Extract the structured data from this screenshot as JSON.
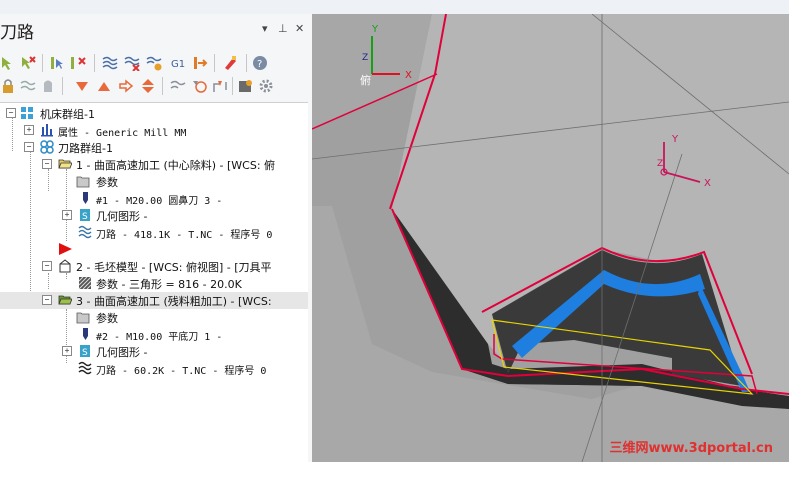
{
  "panel": {
    "title": "刀路",
    "pin_buttons": [
      "▾",
      "⊥",
      "✕"
    ]
  },
  "toolbar": {
    "row1_icons": [
      "select-icon",
      "toggle-select-icon",
      "verify-icon",
      "verify-off-icon",
      "regen-icon",
      "regen-dirty-icon",
      "backplot-icon",
      "g1-icon",
      "post-icon",
      "highlight-icon",
      "help-icon"
    ],
    "row2_icons": [
      "lock-icon",
      "hide-icon",
      "display-icon",
      "move-down-icon",
      "move-up-icon",
      "insert-arrow-icon",
      "expand-icon",
      "collapse-icon",
      "filter-icon",
      "reorder-icon",
      "stock-icon"
    ]
  },
  "tree": {
    "items": [
      {
        "label": "机床群组-1"
      },
      {
        "label": "属性 - Generic Mill MM"
      },
      {
        "label": "刀路群组-1"
      },
      {
        "label": "1 - 曲面高速加工 (中心除料) - [WCS: 俯"
      },
      {
        "label": "参数"
      },
      {
        "label": "#1 - M20.00 圆鼻刀 3 -"
      },
      {
        "label": "几何图形 -"
      },
      {
        "label": "刀路 - 418.1K - T.NC - 程序号 0"
      },
      {
        "label": ""
      },
      {
        "label": "2 - 毛坯模型 - [WCS: 俯视图] - [刀具平"
      },
      {
        "label": "参数 - 三角形 = 816 - 20.0K"
      },
      {
        "label": "3 - 曲面高速加工 (残料粗加工) - [WCS:"
      },
      {
        "label": "参数"
      },
      {
        "label": "#2 - M10.00 平底刀 1 -"
      },
      {
        "label": "几何图形 -"
      },
      {
        "label": "刀路 - 60.2K - T.NC - 程序号 0"
      }
    ]
  },
  "viewport": {
    "axis_labels": {
      "x": "X",
      "y": "Y",
      "z": "Z"
    },
    "view_label": "俯",
    "watermark": "三维网www.3dportal.cn"
  }
}
